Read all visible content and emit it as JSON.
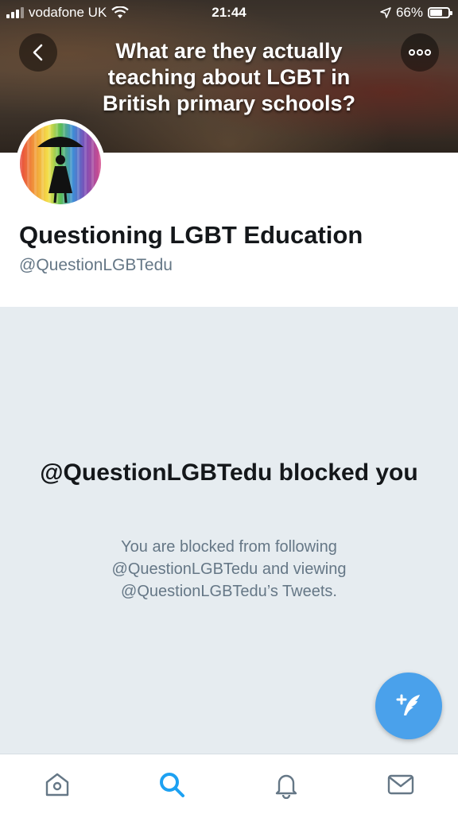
{
  "status_bar": {
    "carrier": "vodafone UK",
    "time": "21:44",
    "battery_percent": "66%",
    "battery_level": 0.66
  },
  "banner": {
    "text": "What are they actually teaching about LGBT in British primary schools?"
  },
  "profile": {
    "name": "Questioning LGBT Education",
    "handle": "@QuestionLGBTedu"
  },
  "blocked": {
    "title": "@QuestionLGBTedu blocked you",
    "description": "You are blocked from following @QuestionLGBTedu and viewing @QuestionLGBTedu’s Tweets."
  },
  "icons": {
    "back": "chevron-left-icon",
    "more": "more-icon",
    "compose": "compose-tweet-icon",
    "home": "home-icon",
    "search": "search-icon",
    "notifications": "bell-icon",
    "messages": "mail-icon"
  },
  "colors": {
    "accent": "#1da1f2",
    "fab": "#4aa1eb",
    "muted_text": "#657786",
    "background": "#e6ecf0"
  }
}
